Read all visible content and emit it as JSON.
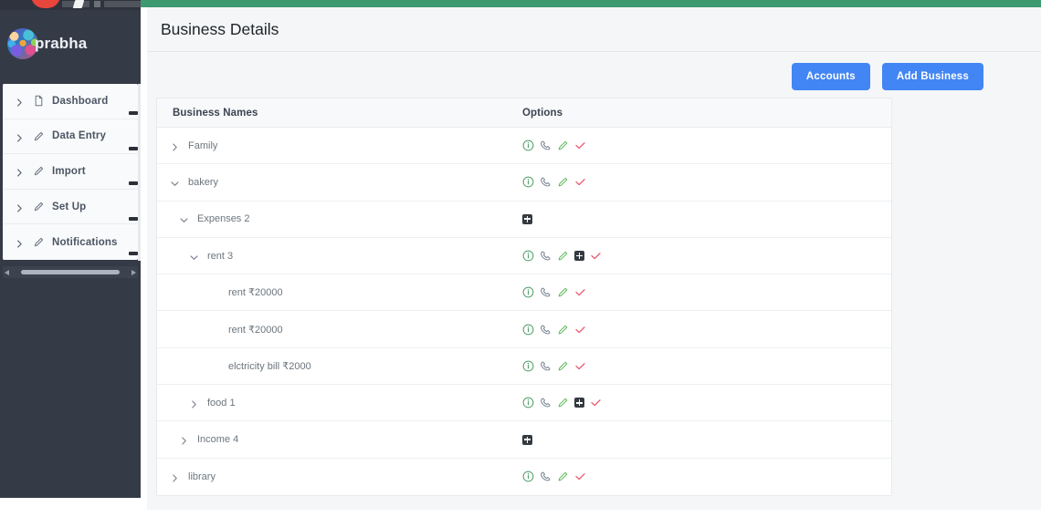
{
  "brand": {
    "name": "prabha",
    "avatar_icon": "user-avatar-image"
  },
  "sidebar": {
    "items": [
      {
        "label": "Dashboard",
        "icon": "file-icon",
        "chevron": "chevron-right-icon"
      },
      {
        "label": "Data Entry",
        "icon": "pencil-icon",
        "chevron": "chevron-right-icon"
      },
      {
        "label": "Import",
        "icon": "pencil-icon",
        "chevron": "chevron-right-icon"
      },
      {
        "label": "Set Up",
        "icon": "pencil-icon",
        "chevron": "chevron-right-icon"
      },
      {
        "label": "Notifications",
        "icon": "pencil-icon",
        "chevron": "chevron-right-icon"
      }
    ]
  },
  "header": {
    "title": "Business Details"
  },
  "toolbar": {
    "accounts_label": "Accounts",
    "add_business_label": "Add Business",
    "button_color": "#4285f4"
  },
  "table": {
    "columns": {
      "names": "Business Names",
      "options": "Options"
    },
    "rows": [
      {
        "label": "Family",
        "depth": 0,
        "toggle": "collapsed",
        "options": [
          "info",
          "phone",
          "edit",
          "check"
        ]
      },
      {
        "label": "bakery",
        "depth": 0,
        "toggle": "expanded",
        "options": [
          "info",
          "phone",
          "edit",
          "check"
        ]
      },
      {
        "label": "Expenses 2",
        "depth": 1,
        "toggle": "expanded",
        "options": [
          "plus"
        ]
      },
      {
        "label": "rent 3",
        "depth": 2,
        "toggle": "expanded",
        "options": [
          "info",
          "phone",
          "edit",
          "plus",
          "check"
        ]
      },
      {
        "label": "rent ₹20000",
        "depth": 3,
        "toggle": "none",
        "options": [
          "info",
          "phone",
          "edit",
          "check"
        ]
      },
      {
        "label": "rent ₹20000",
        "depth": 3,
        "toggle": "none",
        "options": [
          "info",
          "phone",
          "edit",
          "check"
        ]
      },
      {
        "label": "elctricity bill ₹2000",
        "depth": 3,
        "toggle": "none",
        "options": [
          "info",
          "phone",
          "edit",
          "check"
        ]
      },
      {
        "label": "food 1",
        "depth": 2,
        "toggle": "collapsed",
        "options": [
          "info",
          "phone",
          "edit",
          "plus",
          "check"
        ]
      },
      {
        "label": "Income 4",
        "depth": 1,
        "toggle": "collapsed",
        "options": [
          "plus"
        ]
      },
      {
        "label": "library",
        "depth": 0,
        "toggle": "collapsed",
        "options": [
          "info",
          "phone",
          "edit",
          "check"
        ]
      }
    ]
  },
  "icon_names": {
    "info": "info-circle-icon",
    "phone": "phone-icon",
    "edit": "pencil-edit-icon",
    "check": "check-icon",
    "plus": "add-plus-icon"
  },
  "colors": {
    "sidebar_bg": "#343a46",
    "accent_green": "#3d9970",
    "button_blue": "#4285f4",
    "icon_info": "#4f9d69",
    "icon_phone": "#6c7a89",
    "icon_edit": "#5cb85c",
    "icon_check": "#e8546b",
    "icon_plus_bg": "#343a40"
  }
}
